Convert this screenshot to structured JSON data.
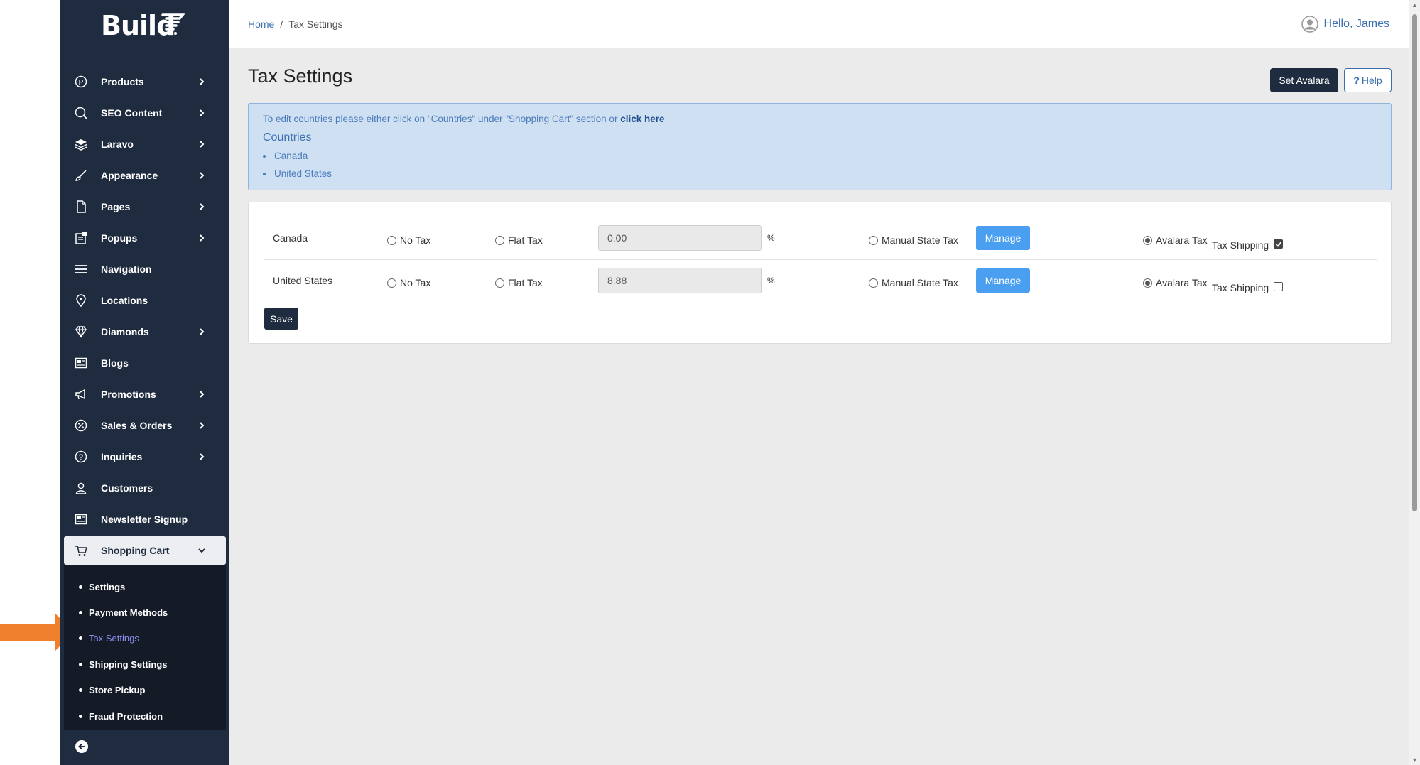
{
  "brand": {
    "logo_text": "Build"
  },
  "sidebar": {
    "items": [
      {
        "label": "Products",
        "icon": "products-icon",
        "has_chevron": true
      },
      {
        "label": "SEO Content",
        "icon": "seo-icon",
        "has_chevron": true
      },
      {
        "label": "Laravo",
        "icon": "layers-icon",
        "has_chevron": true
      },
      {
        "label": "Appearance",
        "icon": "brush-icon",
        "has_chevron": true
      },
      {
        "label": "Pages",
        "icon": "page-icon",
        "has_chevron": true
      },
      {
        "label": "Popups",
        "icon": "popup-icon",
        "has_chevron": true
      },
      {
        "label": "Navigation",
        "icon": "menu-icon",
        "has_chevron": false
      },
      {
        "label": "Locations",
        "icon": "location-pin-icon",
        "has_chevron": false
      },
      {
        "label": "Diamonds",
        "icon": "diamond-icon",
        "has_chevron": true
      },
      {
        "label": "Blogs",
        "icon": "newspaper-icon",
        "has_chevron": false
      },
      {
        "label": "Promotions",
        "icon": "megaphone-icon",
        "has_chevron": true
      },
      {
        "label": "Sales & Orders",
        "icon": "percent-icon",
        "has_chevron": true
      },
      {
        "label": "Inquiries",
        "icon": "question-icon",
        "has_chevron": true
      },
      {
        "label": "Customers",
        "icon": "user-icon",
        "has_chevron": false
      },
      {
        "label": "Newsletter Signup",
        "icon": "newspaper-icon",
        "has_chevron": false
      },
      {
        "label": "Shopping Cart",
        "icon": "cart-icon",
        "has_chevron": true
      }
    ],
    "submenu": [
      {
        "label": "Settings"
      },
      {
        "label": "Payment Methods"
      },
      {
        "label": "Tax Settings"
      },
      {
        "label": "Shipping Settings"
      },
      {
        "label": "Store Pickup"
      },
      {
        "label": "Fraud Protection"
      }
    ]
  },
  "header": {
    "breadcrumb_home": "Home",
    "breadcrumb_sep": "/",
    "breadcrumb_current": "Tax Settings",
    "greeting": "Hello, James"
  },
  "page": {
    "title": "Tax Settings",
    "set_avalara_label": "Set Avalara",
    "help_label": "Help",
    "help_glyph": "?"
  },
  "info": {
    "text": "To edit countries please either click on \"Countries\" under \"Shopping Cart\" section or ",
    "link": "click here",
    "countries_title": "Countries",
    "countries": [
      "Canada",
      "United States"
    ]
  },
  "tax_rows": [
    {
      "country": "Canada",
      "no_tax": "No Tax",
      "flat_tax": "Flat Tax",
      "rate": "0.00",
      "pct": "%",
      "manual": "Manual State Tax",
      "manage": "Manage",
      "avalara": "Avalara Tax",
      "ship_label": "Tax Shipping",
      "selected": "avalara",
      "tax_shipping": true
    },
    {
      "country": "United States",
      "no_tax": "No Tax",
      "flat_tax": "Flat Tax",
      "rate": "8.88",
      "pct": "%",
      "manual": "Manual State Tax",
      "manage": "Manage",
      "avalara": "Avalara Tax",
      "ship_label": "Tax Shipping",
      "selected": "avalara",
      "tax_shipping": false
    }
  ],
  "save_label": "Save",
  "colors": {
    "sidebar_bg": "#1f2b3e",
    "accent_link": "#3b6fb0",
    "manage_btn": "#4a9ff0",
    "pointer_arrow": "#f07f2e",
    "active_sub": "#8b8ff0"
  }
}
